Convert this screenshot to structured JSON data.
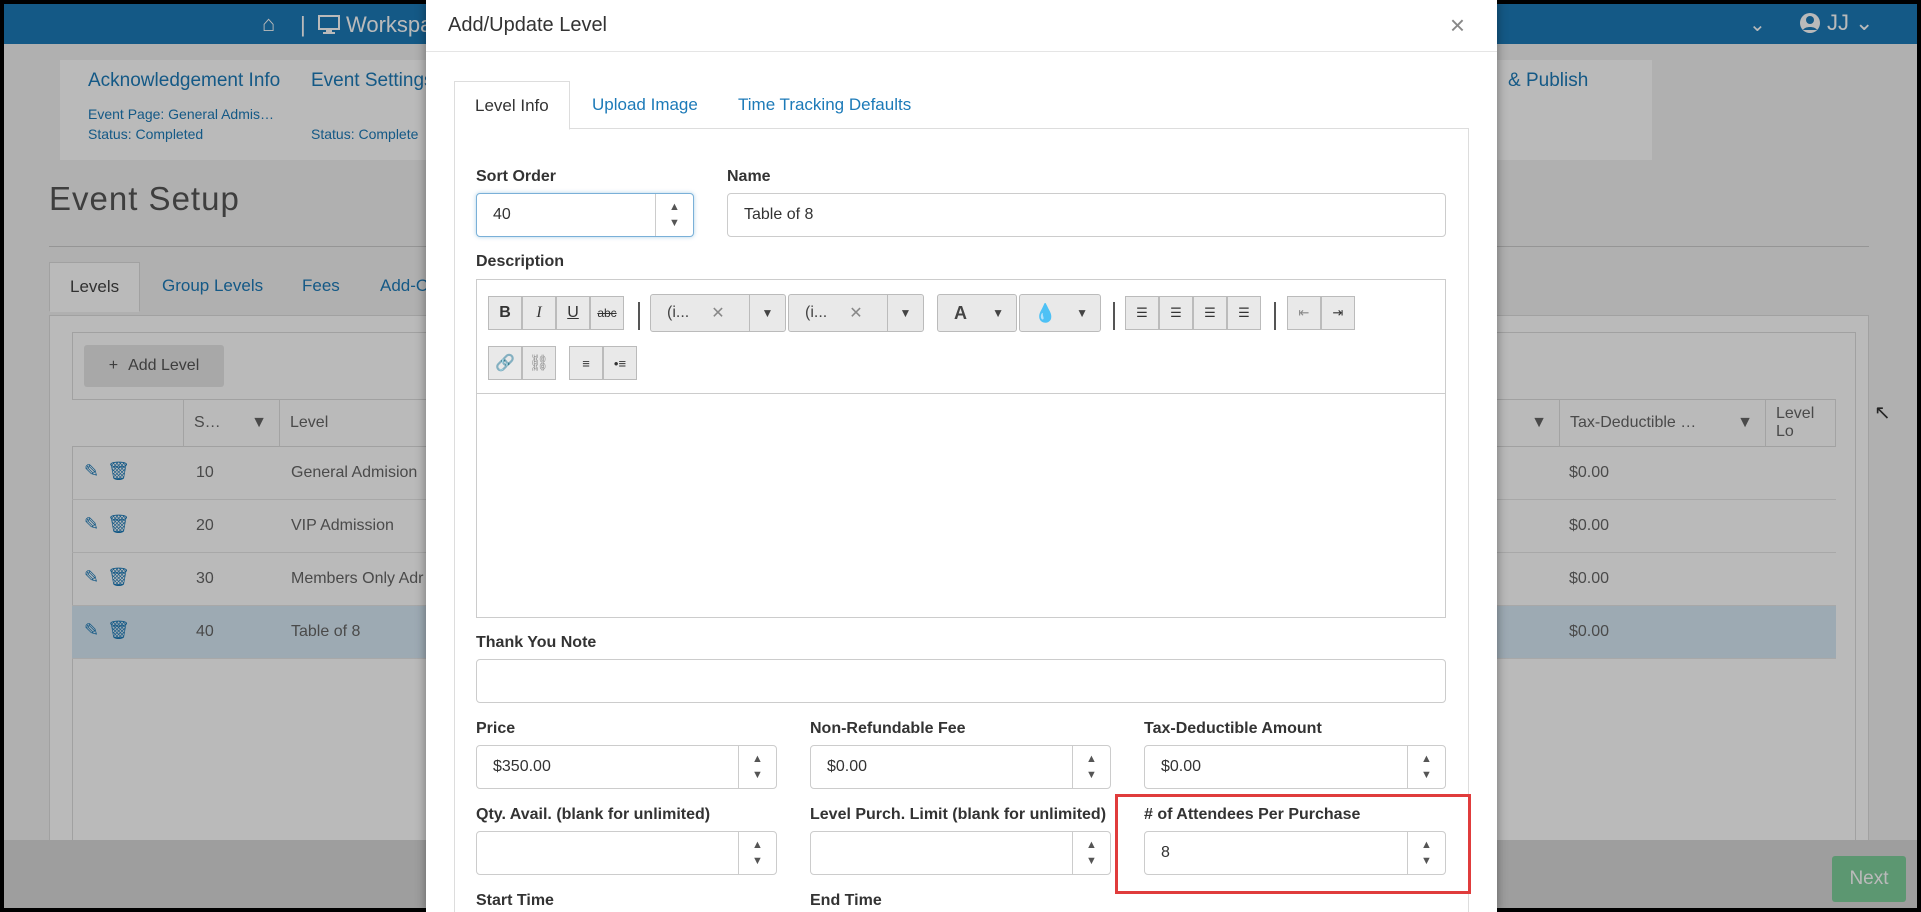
{
  "background": {
    "topbar": {
      "home_icon": "⌂",
      "separator": "|",
      "workspace_label": "Workspa",
      "user_initials": "JJ"
    },
    "steps": [
      {
        "title": "Acknowledgement Info",
        "sub1": "Event Page: General Admis…",
        "sub2": "Status: Completed"
      },
      {
        "title": "Event Settings",
        "sub1": "",
        "sub2": "Status: Complete"
      },
      {
        "title": "& Publish",
        "sub1": "",
        "sub2": ""
      }
    ],
    "page_title": "Event Setup",
    "tabs": [
      "Levels",
      "Group Levels",
      "Fees",
      "Add-O"
    ],
    "add_level_label": "Add Level",
    "columns": [
      "S…",
      "Level",
      "Tax-Deductible …",
      "Level Lo"
    ],
    "rows": [
      {
        "sort": "10",
        "level": "General Admision",
        "tax": "$0.00"
      },
      {
        "sort": "20",
        "level": "VIP Admission",
        "tax": "$0.00"
      },
      {
        "sort": "30",
        "level": "Members Only Adr",
        "tax": "$0.00"
      },
      {
        "sort": "40",
        "level": "Table of 8",
        "tax": "$0.00"
      }
    ],
    "next_label": "Next"
  },
  "modal": {
    "title": "Add/Update Level",
    "close": "×",
    "tabs": [
      "Level Info",
      "Upload Image",
      "Time Tracking Defaults"
    ],
    "sort_order": {
      "label": "Sort Order",
      "value": "40"
    },
    "name": {
      "label": "Name",
      "value": "Table of 8"
    },
    "description": {
      "label": "Description",
      "font_dropdown": "(i...",
      "size_dropdown": "(i...",
      "clear": "✕"
    },
    "thank_you": {
      "label": "Thank You Note",
      "value": ""
    },
    "price": {
      "label": "Price",
      "value": "$350.00"
    },
    "nonref_fee": {
      "label": "Non-Refundable Fee",
      "value": "$0.00"
    },
    "tax_deductible": {
      "label": "Tax-Deductible Amount",
      "value": "$0.00"
    },
    "qty_avail": {
      "label": "Qty. Avail. (blank for unlimited)",
      "value": ""
    },
    "purch_limit": {
      "label": "Level Purch. Limit (blank for unlimited)",
      "value": ""
    },
    "attendees": {
      "label": "# of Attendees Per Purchase",
      "value": "8"
    },
    "start_time": {
      "label": "Start Time"
    },
    "end_time": {
      "label": "End Time"
    }
  },
  "colors": {
    "accent": "#1c7ab8",
    "highlight": "#e03c3c",
    "next": "#7fcf9b"
  }
}
